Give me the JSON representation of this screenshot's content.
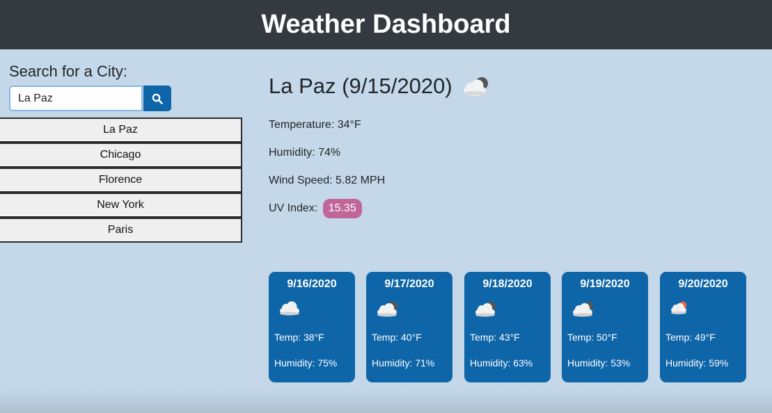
{
  "header": {
    "title": "Weather Dashboard"
  },
  "search": {
    "title": "Search for a City:",
    "value": "La Paz",
    "icon": "search-icon"
  },
  "cities": [
    "La Paz",
    "Chicago",
    "Florence",
    "New York",
    "Paris"
  ],
  "current": {
    "title": "La Paz (9/15/2020)",
    "icon": "cloudy-night-icon",
    "temperature": "Temperature: 34°F",
    "humidity": "Humidity: 74%",
    "wind": "Wind Speed: 5.82 MPH",
    "uv_label": "UV Index:",
    "uv_value": "15.35",
    "uv_color": "#c0669a"
  },
  "forecast": [
    {
      "date": "9/16/2020",
      "icon": "cloud-icon",
      "temp": "Temp: 38°F",
      "humidity": "Humidity: 75%"
    },
    {
      "date": "9/17/2020",
      "icon": "cloudy-night-icon",
      "temp": "Temp: 40°F",
      "humidity": "Humidity: 71%"
    },
    {
      "date": "9/18/2020",
      "icon": "cloudy-night-icon",
      "temp": "Temp: 43°F",
      "humidity": "Humidity: 63%"
    },
    {
      "date": "9/19/2020",
      "icon": "cloudy-night-icon",
      "temp": "Temp: 50°F",
      "humidity": "Humidity: 53%"
    },
    {
      "date": "9/20/2020",
      "icon": "cloudy-day-icon",
      "temp": "Temp: 49°F",
      "humidity": "Humidity: 59%"
    }
  ],
  "colors": {
    "header": "#343a40",
    "accent": "#0e65a8",
    "background": "#c4d8ea"
  }
}
